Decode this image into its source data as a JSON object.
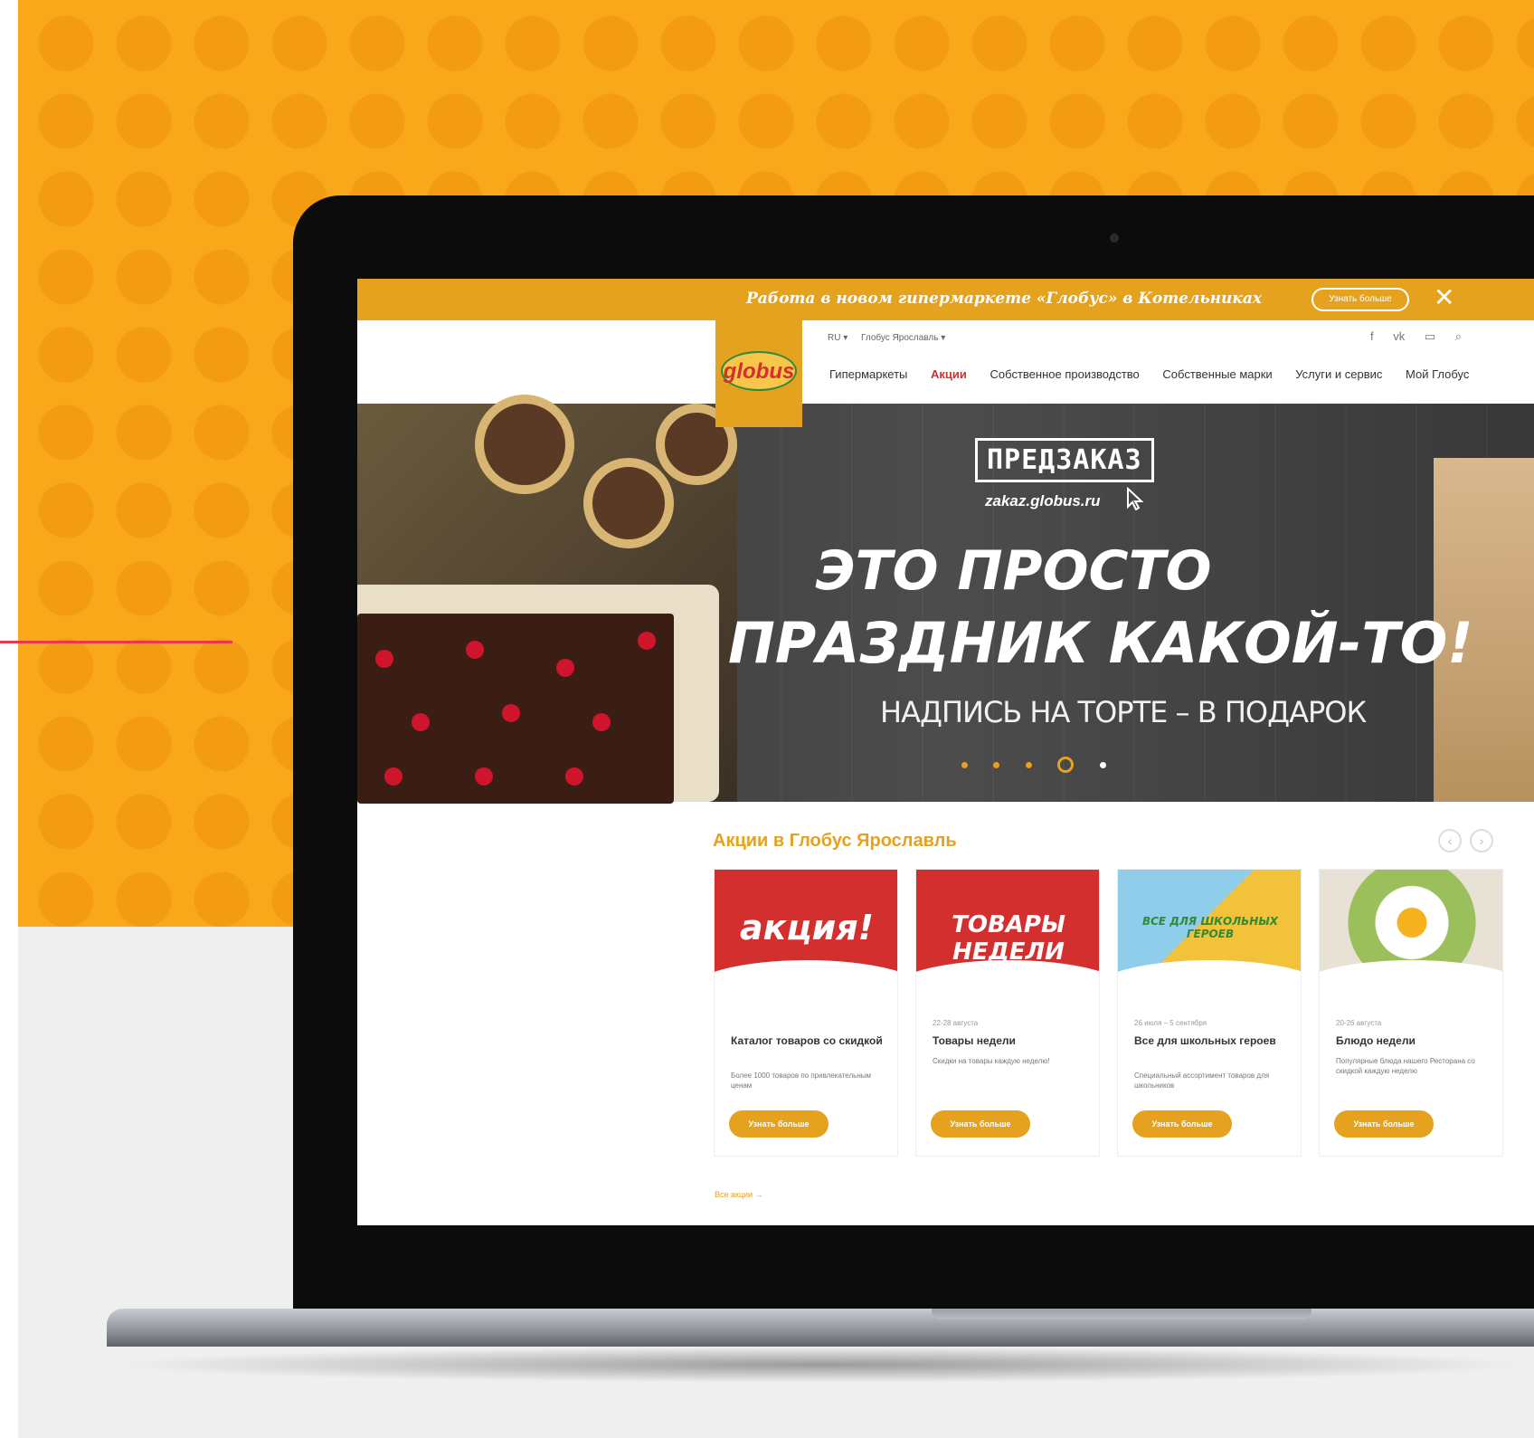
{
  "colors": {
    "accent": "#E5A21F",
    "background": "#F9A81A",
    "red": "#D32F2F"
  },
  "announcement": {
    "text": "Работа в новом гипермаркете «Глобус» в Котельниках",
    "button": "Узнать больше",
    "close_icon": "close-icon"
  },
  "header": {
    "logo": "globus",
    "language": "RU ▾",
    "city": "Глобус Ярославль ▾",
    "social": [
      "facebook-icon",
      "vk-icon",
      "youtube-icon",
      "search-icon"
    ],
    "nav": [
      "Гипермаркеты",
      "Акции",
      "Собственное производство",
      "Собственные марки",
      "Услуги и сервис",
      "Мой Глобус"
    ],
    "active_nav": "Акции"
  },
  "hero": {
    "badge": "ПРЕДЗАКАЗ",
    "url": "zakaz.globus.ru",
    "line1": "ЭТО ПРОСТО",
    "line2": "ПРАЗДНИК КАКОЙ-ТО!",
    "subtitle": "НАДПИСЬ НА ТОРТЕ – В ПОДАРОК",
    "slides_count": 5,
    "active_slide": 4
  },
  "promos": {
    "title": "Акции в Глобус Ярославль",
    "all_link": "Все акции →",
    "cards": [
      {
        "badge": "акция!",
        "date": "",
        "title": "Каталог товаров со скидкой",
        "desc": "Более 1000 товаров по привлекательным ценам",
        "button": "Узнать больше"
      },
      {
        "badge": "ТОВАРЫ НЕДЕЛИ",
        "date": "22-28 августа",
        "title": "Товары недели",
        "desc": "Скидки на товары каждую неделю!",
        "button": "Узнать больше"
      },
      {
        "badge": "ВСЕ ДЛЯ ШКОЛЬНЫХ ГЕРОЕВ",
        "date": "26 июля – 5 сентября",
        "title": "Все для школьных героев",
        "desc": "Специальный ассортимент товаров для школьников",
        "button": "Узнать больше"
      },
      {
        "badge": "",
        "date": "20-26 августа",
        "title": "Блюдо недели",
        "desc": "Популярные блюда нашего Ресторана со скидкой каждую неделю",
        "button": "Узнать больше"
      }
    ]
  }
}
